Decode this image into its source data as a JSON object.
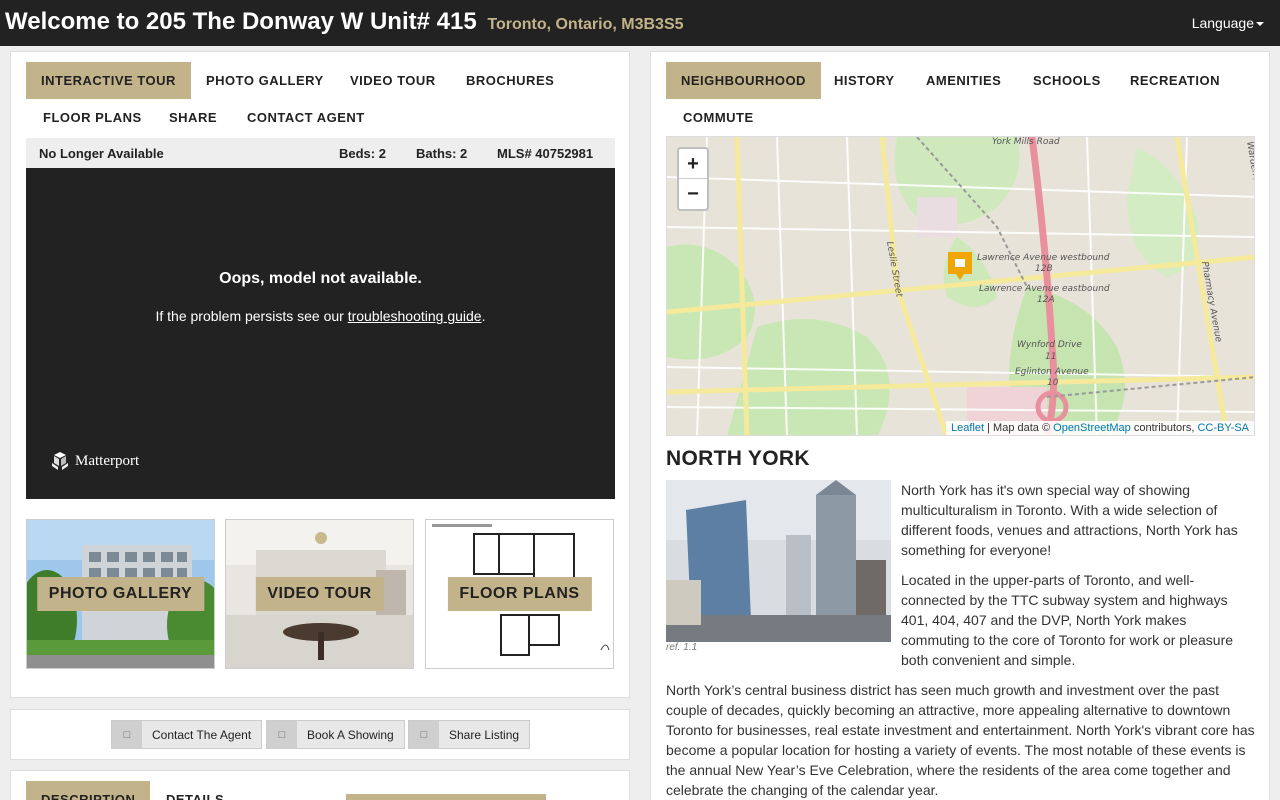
{
  "header": {
    "title": "Welcome to 205 The Donway W Unit# 415",
    "location": "Toronto, Ontario, M3B3S5",
    "language": "Language"
  },
  "media_tabs": [
    "INTERACTIVE TOUR",
    "PHOTO GALLERY",
    "VIDEO TOUR",
    "BROCHURES",
    "FLOOR PLANS",
    "SHARE",
    "CONTACT AGENT"
  ],
  "listing": {
    "status": "No Longer Available",
    "beds": "Beds: 2",
    "baths": "Baths: 2",
    "mls": "MLS# 40752981"
  },
  "tour": {
    "error_title": "Oops, model not available.",
    "persist_prefix": "If the problem persists see our ",
    "guide_link": "troubleshooting guide",
    "persist_suffix": ".",
    "brand": "Matterport"
  },
  "thumbnails": [
    "PHOTO GALLERY",
    "VIDEO TOUR",
    "FLOOR PLANS"
  ],
  "cta": [
    "Contact The Agent",
    "Book A Showing",
    "Share Listing"
  ],
  "cta_icon": "□",
  "desc_tabs": [
    "DESCRIPTION",
    "DETAILS"
  ],
  "neighbourhood_tabs": [
    "NEIGHBOURHOOD",
    "HISTORY",
    "AMENITIES",
    "SCHOOLS",
    "RECREATION",
    "COMMUTE"
  ],
  "map": {
    "zoom_in": "+",
    "zoom_out": "−",
    "labels": [
      "York Mills Road",
      "Lawrence Avenue westbound",
      "12B",
      "Lawrence Avenue eastbound",
      "12A",
      "Wynford Drive",
      "11",
      "Eglinton Avenue",
      "10",
      "Leslie Street",
      "Pharmacy Avenue",
      "Warden Avenue"
    ],
    "attribution": {
      "leaflet": "Leaflet",
      "sep": " | Map data © ",
      "osm": "OpenStreetMap",
      "contrib": " contributors, ",
      "license": "CC-BY-SA"
    }
  },
  "neighbourhood": {
    "title": "NORTH YORK",
    "photo_ref": "ref. 1.1",
    "p1": "North York has it's own special way of showing multiculturalism in Toronto. With a wide selection of different foods, venues and attractions, North York has something for everyone!",
    "p2": "Located in the upper-parts of Toronto, and well-connected by the TTC subway system and highways 401, 404, 407 and the DVP, North York makes commuting to the core of Toronto for work or pleasure both convenient and simple.",
    "p3": "North York’s central business district has seen much growth and investment over the past couple of decades, quickly becoming an attractive, more appealing alternative to downtown Toronto for businesses, real estate investment and entertainment. North York's vibrant core has become a popular location for hosting a variety of events. The most notable of these events is the annual New Year’s Eve Celebration, where the residents of the area come together and celebrate the changing of the calendar year."
  },
  "colors": {
    "accent": "#c3b38a",
    "header_bg": "#222222",
    "link": "#0078a8"
  }
}
